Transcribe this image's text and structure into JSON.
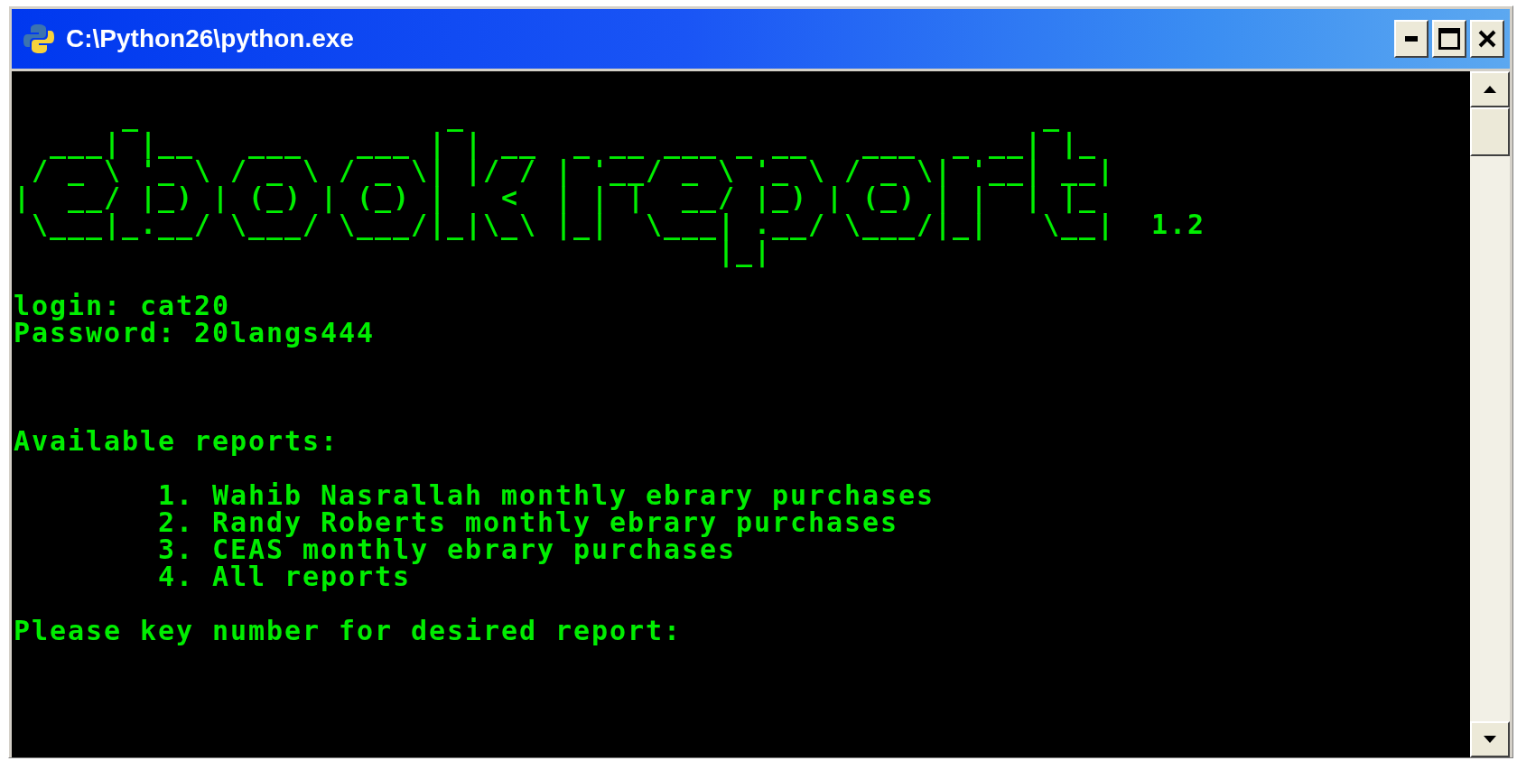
{
  "window": {
    "title": "C:\\Python26\\python.exe"
  },
  "console": {
    "banner": {
      "lines": [
        "      _                 _                                _",
        "  ___| |__   ___   ___ | | __  _ __ ___ _ __   ___  _ __| |_",
        " / _ \\ '_ \\ / _ \\ / _ \\| |/ / | '__/ _ \\ '_ \\ / _ \\| '__| __|",
        "|  __/ |_) | (_) | (_) |   <  | | |  __/ |_) | (_) | |  | |_",
        " \\___|_.__/ \\___/ \\___/|_|\\_\\ |_|  \\___| .__/ \\___/|_|   \\__|",
        "                                       |_|"
      ],
      "version": "1.2"
    },
    "login_line": "login: cat20",
    "password_line": "Password: 20langs444",
    "reports_heading": "Available reports:",
    "reports": [
      "1. Wahib Nasrallah monthly ebrary purchases",
      "2. Randy Roberts monthly ebrary purchases",
      "3. CEAS monthly ebrary purchases",
      "4. All reports"
    ],
    "prompt": "Please key number for desired report:"
  }
}
